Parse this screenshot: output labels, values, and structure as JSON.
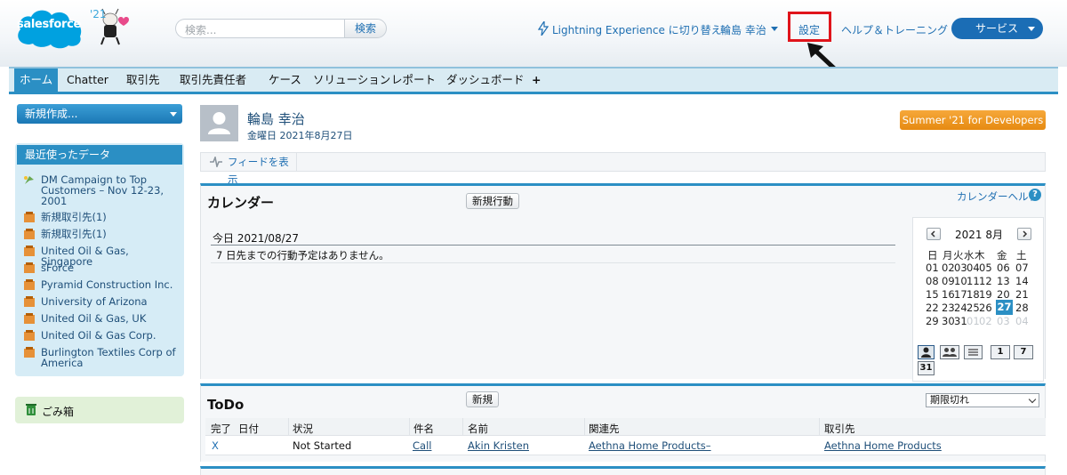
{
  "header": {
    "logo_text": "salesforce",
    "year_badge": "'21",
    "search_placeholder": "検索...",
    "search_button": "検索",
    "lightning_switch": "Lightning Experience に切り替え",
    "user_menu": "輪島 幸治",
    "setup": "設定",
    "help_training": "ヘルプ＆トレーニング",
    "app_menu": "サービス"
  },
  "tabs": [
    {
      "label": "ホーム",
      "active": true
    },
    {
      "label": "Chatter"
    },
    {
      "label": "取引先"
    },
    {
      "label": "取引先責任者"
    },
    {
      "label": "ケース"
    },
    {
      "label": "ソリューション"
    },
    {
      "label": "レポート"
    },
    {
      "label": "ダッシュボード"
    },
    {
      "label": "+"
    }
  ],
  "sidebar": {
    "create_new": "新規作成...",
    "recent_title": "最近使ったデータ",
    "recent_items": [
      {
        "label": "DM Campaign to Top Customers – Nov 12-23, 2001",
        "icon": "campaign-icon"
      },
      {
        "label": "新規取引先(1)",
        "icon": "account-icon"
      },
      {
        "label": "新規取引先(1)",
        "icon": "account-icon"
      },
      {
        "label": "United Oil & Gas, Singapore",
        "icon": "account-icon"
      },
      {
        "label": "sForce",
        "icon": "account-icon"
      },
      {
        "label": "Pyramid Construction Inc.",
        "icon": "account-icon"
      },
      {
        "label": "University of Arizona",
        "icon": "account-icon"
      },
      {
        "label": "United Oil & Gas, UK",
        "icon": "account-icon"
      },
      {
        "label": "United Oil & Gas Corp.",
        "icon": "account-icon"
      },
      {
        "label": "Burlington Textiles Corp of America",
        "icon": "account-icon"
      }
    ],
    "recycle_bin": "ごみ箱"
  },
  "profile": {
    "name": "輪島 幸治",
    "date": "金曜日 2021年8月27日",
    "promo_button": "Summer '21 for Developers",
    "show_feed": "フィードを表示"
  },
  "calendar": {
    "title": "カレンダー",
    "new_event": "新規行動",
    "help": "カレンダーヘルプ",
    "help_glyph": "?",
    "today_heading": "今日 2021/08/27",
    "no_events": "7 日先までの行動予定はありません。",
    "mini": {
      "month": "2021 8月",
      "weekdays": [
        "日",
        "月",
        "火",
        "水",
        "木",
        "金",
        "土"
      ],
      "weeks": [
        [
          "01",
          "02",
          "03",
          "04",
          "05",
          "06",
          "07"
        ],
        [
          "08",
          "09",
          "10",
          "11",
          "12",
          "13",
          "14"
        ],
        [
          "15",
          "16",
          "17",
          "18",
          "19",
          "20",
          "21"
        ],
        [
          "22",
          "23",
          "24",
          "25",
          "26",
          "27",
          "28"
        ],
        [
          "29",
          "30",
          "31",
          "01",
          "02",
          "03",
          "04"
        ]
      ],
      "today": "27",
      "views": [
        "1",
        "7",
        "31"
      ]
    }
  },
  "todo": {
    "title": "ToDo",
    "new_button": "新規",
    "filter": "期限切れ",
    "columns": [
      "完了",
      "日付",
      "状況",
      "件名",
      "名前",
      "関連先",
      "取引先"
    ],
    "rows": [
      {
        "done": "X",
        "date": "",
        "status": "Not Started",
        "subject": "Call",
        "name": "Akin Kristen",
        "related": "Aethna Home Products–",
        "account": "Aethna Home Products"
      }
    ]
  },
  "colors": {
    "brand": "#00a1e0",
    "tab_active": "#2b8fc4",
    "highlight_box": "#e0141b",
    "promo": "#e68a11"
  }
}
